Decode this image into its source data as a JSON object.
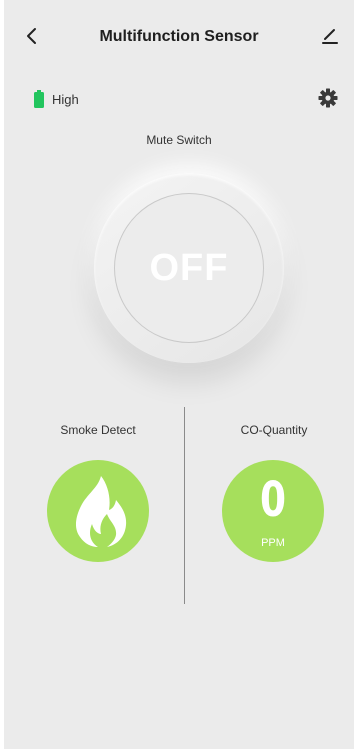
{
  "header": {
    "title": "Multifunction Sensor",
    "back_icon": "chevron-left-icon",
    "edit_icon": "edit-pencil-icon"
  },
  "battery": {
    "level_text": "High",
    "icon": "battery-full-icon",
    "color": "#22c55e"
  },
  "settings": {
    "icon": "gear-icon"
  },
  "mute_switch": {
    "label": "Mute Switch",
    "state": "OFF"
  },
  "smoke": {
    "label": "Smoke Detect",
    "icon": "flame-icon"
  },
  "co": {
    "label": "CO-Quantity",
    "value": "0",
    "unit": "PPM"
  },
  "colors": {
    "accent_green": "#a6df5c",
    "background": "#ebebeb"
  }
}
